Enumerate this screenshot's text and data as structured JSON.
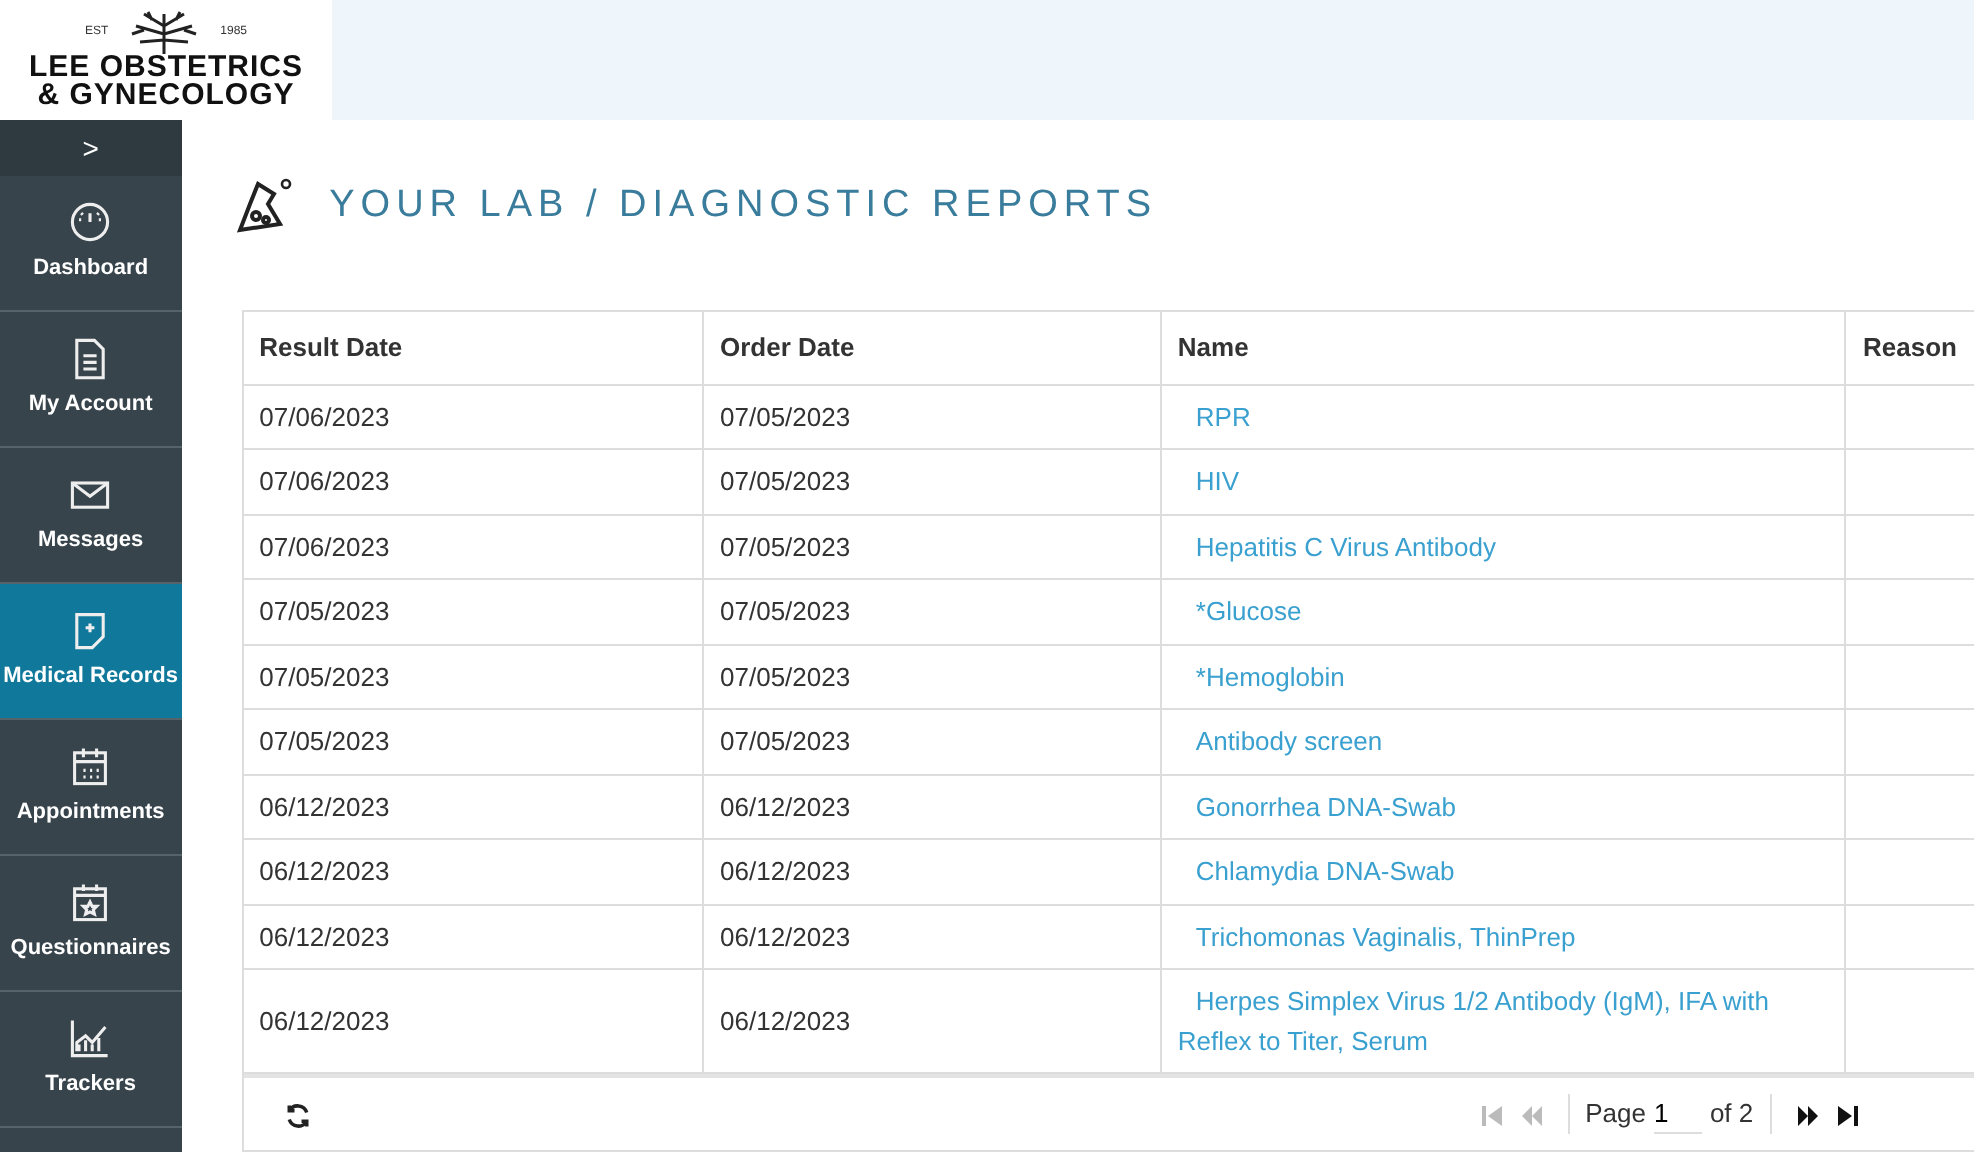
{
  "logo": {
    "est": "EST",
    "year": "1985",
    "line1": "LEE OBSTETRICS",
    "line2": "& GYNECOLOGY"
  },
  "sidebar": {
    "toggle": ">",
    "items": [
      {
        "label": "Dashboard",
        "kind": "gauge",
        "selected": false
      },
      {
        "label": "My Account",
        "kind": "document",
        "selected": false
      },
      {
        "label": "Messages",
        "kind": "envelope",
        "selected": false
      },
      {
        "label": "Medical Records",
        "kind": "record",
        "selected": true
      },
      {
        "label": "Appointments",
        "kind": "calendar",
        "selected": false
      },
      {
        "label": "Questionnaires",
        "kind": "star-calendar",
        "selected": false
      },
      {
        "label": "Trackers",
        "kind": "chart",
        "selected": false
      }
    ]
  },
  "page_title": "YOUR LAB / DIAGNOSTIC REPORTS",
  "table": {
    "columns": [
      "Result Date",
      "Order Date",
      "Name",
      "Reason"
    ],
    "rows": [
      [
        "07/06/2023",
        "07/05/2023",
        "RPR"
      ],
      [
        "07/06/2023",
        "07/05/2023",
        "HIV"
      ],
      [
        "07/06/2023",
        "07/05/2023",
        "Hepatitis C Virus Antibody"
      ],
      [
        "07/05/2023",
        "07/05/2023",
        "*Glucose"
      ],
      [
        "07/05/2023",
        "07/05/2023",
        "*Hemoglobin"
      ],
      [
        "07/05/2023",
        "07/05/2023",
        "Antibody screen"
      ],
      [
        "06/12/2023",
        "06/12/2023",
        "Gonorrhea DNA-Swab"
      ],
      [
        "06/12/2023",
        "06/12/2023",
        "Chlamydia DNA-Swab"
      ],
      [
        "06/12/2023",
        "06/12/2023",
        "Trichomonas Vaginalis, ThinPrep"
      ],
      [
        "06/12/2023",
        "06/12/2023",
        "Herpes Simplex Virus 1/2 Antibody (IgM), IFA with Reflex to Titer, Serum"
      ]
    ]
  },
  "pager": {
    "first_disabled": true,
    "prev_disabled": true,
    "next_disabled": false,
    "last_disabled": false,
    "page_label": "Page",
    "page_value": "1",
    "of_label": "of 2"
  }
}
